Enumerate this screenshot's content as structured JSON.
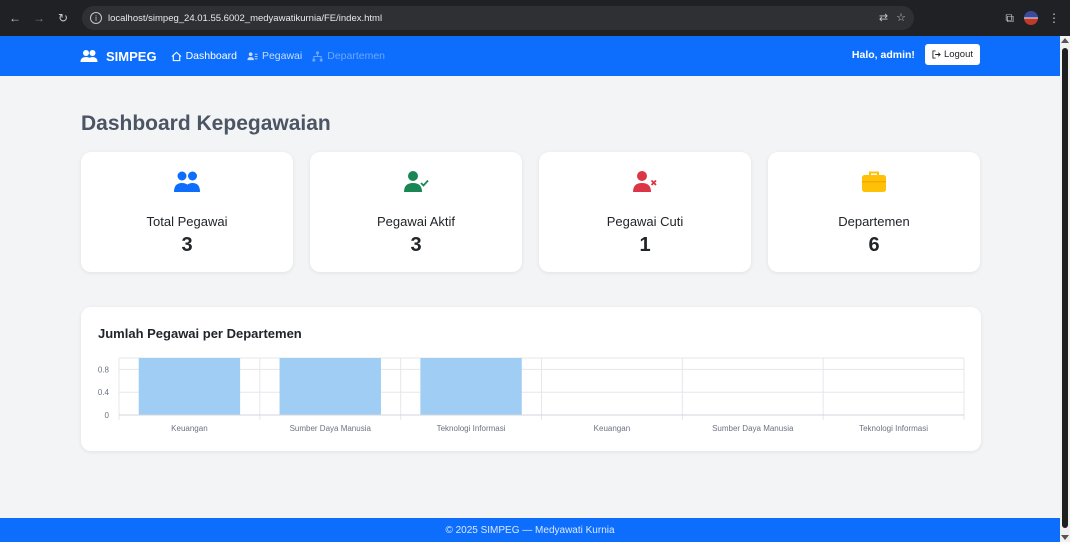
{
  "browser": {
    "url": "localhost/simpeg_24.01.55.6002_medyawatikurnia/FE/index.html"
  },
  "navbar": {
    "brand": "SIMPEG",
    "links": [
      {
        "label": "Dashboard",
        "icon": "home-icon"
      },
      {
        "label": "Pegawai",
        "icon": "users-icon"
      },
      {
        "label": "Departemen",
        "icon": "sitemap-icon"
      }
    ],
    "greeting": "Halo, admin!",
    "logout_label": "Logout"
  },
  "page": {
    "title": "Dashboard Kepegawaian"
  },
  "cards": [
    {
      "label": "Total Pegawai",
      "value": "3",
      "icon": "people-icon",
      "color": "#0d6efd"
    },
    {
      "label": "Pegawai Aktif",
      "value": "3",
      "icon": "user-check-icon",
      "color": "#198754"
    },
    {
      "label": "Pegawai Cuti",
      "value": "1",
      "icon": "user-x-icon",
      "color": "#dc3545"
    },
    {
      "label": "Departemen",
      "value": "6",
      "icon": "briefcase-icon",
      "color": "#ffc107"
    }
  ],
  "chart_title": "Jumlah Pegawai per Departemen",
  "chart_data": {
    "type": "bar",
    "title": "Jumlah Pegawai per Departemen",
    "categories": [
      "Keuangan",
      "Sumber Daya Manusia",
      "Teknologi Informasi",
      "Keuangan",
      "Sumber Daya Manusia",
      "Teknologi Informasi"
    ],
    "values": [
      1,
      1,
      1,
      0,
      0,
      0
    ],
    "yticks": [
      0,
      0.4,
      0.8
    ],
    "ylim": [
      0,
      1
    ],
    "grid": true,
    "bar_color": "#9fcdf3"
  },
  "footer": {
    "text": "© 2025 SIMPEG — Medyawati Kurnia"
  }
}
